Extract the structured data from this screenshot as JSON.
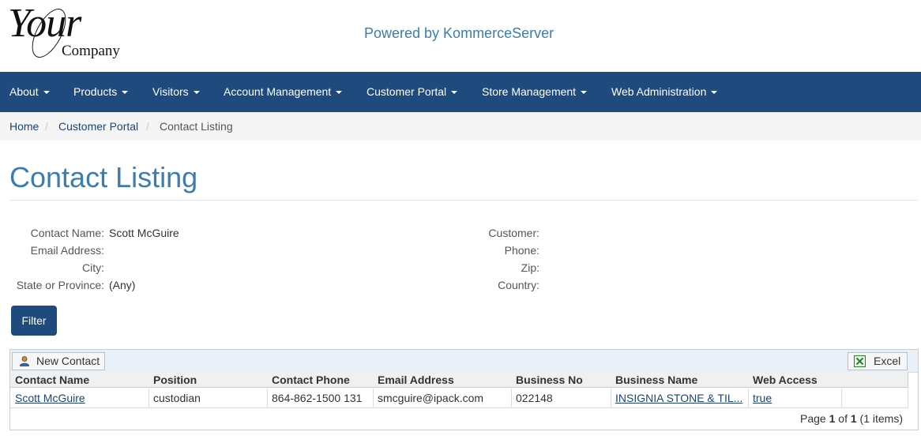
{
  "header": {
    "logo_text": "Your",
    "logo_company": "Company",
    "powered_by": "Powered by KommerceServer"
  },
  "nav": {
    "items": [
      "About",
      "Products",
      "Visitors",
      "Account Management",
      "Customer Portal",
      "Store Management",
      "Web Administration"
    ]
  },
  "breadcrumb": {
    "items": [
      "Home",
      "Customer Portal"
    ],
    "current": "Contact Listing",
    "separator": "/"
  },
  "page": {
    "title": "Contact Listing"
  },
  "filters": {
    "contact_name_label": "Contact Name:",
    "contact_name_value": "Scott McGuire",
    "email_label": "Email Address:",
    "city_label": "City:",
    "state_label": "State or Province:",
    "state_value": "(Any)",
    "customer_label": "Customer:",
    "phone_label": "Phone:",
    "zip_label": "Zip:",
    "country_label": "Country:",
    "filter_button": "Filter"
  },
  "grid": {
    "new_contact": "New Contact",
    "excel": "Excel",
    "columns": [
      "Contact Name",
      "Position",
      "Contact Phone",
      "Email Address",
      "Business No",
      "Business Name",
      "Web Access"
    ],
    "rows": [
      [
        "Scott McGuire",
        "custodian",
        "864-862-1500 131",
        "smcguire@ipack.com",
        "022148",
        "INSIGNIA STONE & TIL...",
        "true"
      ]
    ],
    "pager": {
      "prefix": "Page",
      "page": "1",
      "of": "of",
      "total": "1",
      "items": "(1 items)"
    }
  },
  "colors": {
    "nav_bg": "#1e4a7d",
    "accent": "#3b7dad",
    "link": "#1d4575"
  }
}
